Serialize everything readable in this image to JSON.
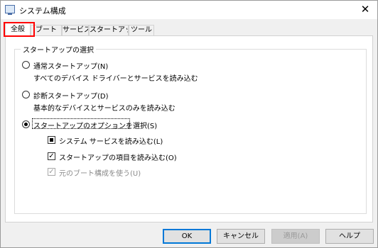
{
  "window": {
    "title": "システム構成",
    "close_symbol": "✕"
  },
  "tabs": [
    {
      "label": "全般",
      "active": true
    },
    {
      "label": "ブート",
      "active": false
    },
    {
      "label": "サービス",
      "active": false
    },
    {
      "label": "スタートアップ",
      "active": false
    },
    {
      "label": "ツール",
      "active": false
    }
  ],
  "group": {
    "legend": "スタートアップの選択",
    "normal": {
      "label": "通常スタートアップ(N)",
      "desc": "すべてのデバイス ドライバーとサービスを読み込む",
      "checked": false
    },
    "diagnostic": {
      "label": "診断スタートアップ(D)",
      "desc": "基本的なデバイスとサービスのみを読み込む",
      "checked": false
    },
    "selective": {
      "label": "スタートアップのオプションを選択(S)",
      "checked": true
    },
    "options": [
      {
        "label": "システム サービスを読み込む(L)",
        "state": "indeterminate"
      },
      {
        "label": "スタートアップの項目を読み込む(O)",
        "state": "checked",
        "tick": "✓"
      },
      {
        "label": "元のブート構成を使う(U)",
        "state": "checked-disabled",
        "tick": "✓"
      }
    ]
  },
  "buttons": {
    "ok": "OK",
    "cancel": "キャンセル",
    "apply": "適用(A)",
    "help": "ヘルプ"
  },
  "colors": {
    "highlight": "#ff0000",
    "accent": "#0078d7"
  }
}
